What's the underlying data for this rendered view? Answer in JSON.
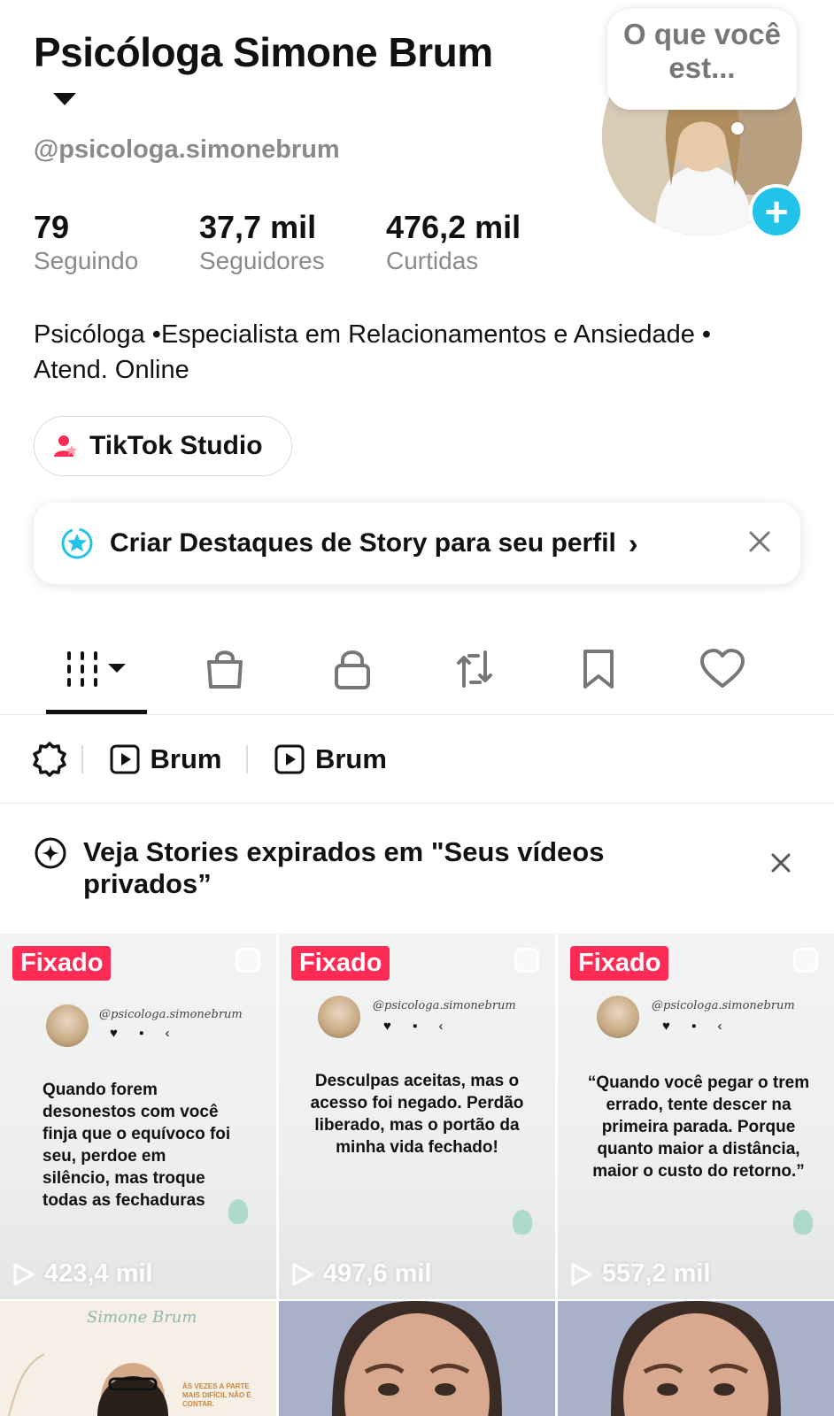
{
  "profile": {
    "name": "Psicóloga Simone Brum",
    "username": "@psicologa.simonebrum",
    "avatar_bubble": "O que você est..."
  },
  "stats": [
    {
      "value": "79",
      "label": "Seguindo"
    },
    {
      "value": "37,7 mil",
      "label": "Seguidores"
    },
    {
      "value": "476,2 mil",
      "label": "Curtidas"
    }
  ],
  "bio": "Psicóloga •Especialista em Relacionamentos e Ansiedade • Atend. Online",
  "studio_button": "TikTok Studio",
  "story_banner": "Criar Destaques de Story para seu perfil",
  "tabs": [
    "videos-icon",
    "shop-icon",
    "lock-icon",
    "repost-icon",
    "bookmark-icon",
    "heart-icon"
  ],
  "playlists": [
    "Brum",
    "Brum"
  ],
  "expired_notice": "Veja Stories expirados em \"Seus vídeos privados”",
  "videos": [
    {
      "pinned": "Fixado",
      "handle": "@psicologa.simonebrum",
      "text": "Quando forem desonestos com você finja que o equívoco foi seu, perdoe em silêncio, mas troque todas as fechaduras",
      "views": "423,4 mil"
    },
    {
      "pinned": "Fixado",
      "handle": "@psicologa.simonebrum",
      "text": "Desculpas aceitas, mas o acesso foi negado. Perdão liberado, mas o portão da minha vida fechado!",
      "views": "497,6 mil"
    },
    {
      "pinned": "Fixado",
      "handle": "@psicologa.simonebrum",
      "text": "“Quando você pegar o trem errado, tente descer na primeira parada. Porque quanto maior a distância, maior o custo do retorno.”",
      "views": "557,2 mil"
    }
  ],
  "bottom_tiles": [
    {
      "brand": "Simone Brum",
      "caption": "ÀS VEZES A PARTE MAIS DIFÍCIL NÃO É CONTAR."
    }
  ],
  "colors": {
    "pin": "#fe2c55",
    "add": "#21c4e8",
    "muted": "#8a8a8a"
  }
}
